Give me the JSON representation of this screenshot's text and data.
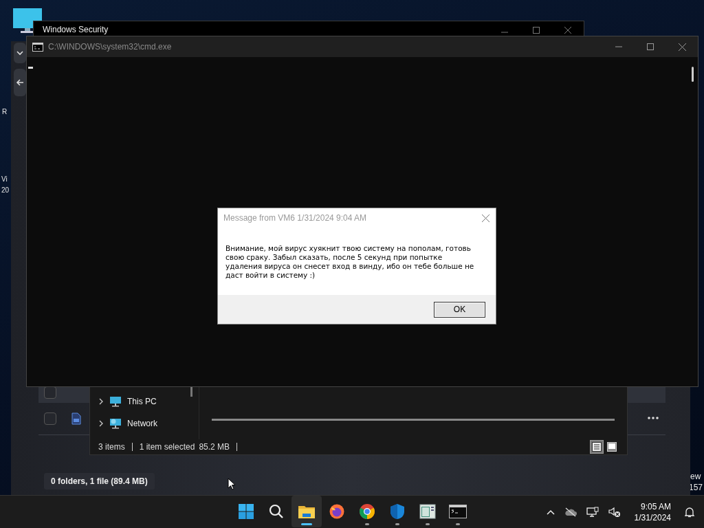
{
  "desktop": {
    "partial_texts": [
      "R",
      "Vi",
      "20",
      "ew",
      "157"
    ]
  },
  "security_window": {
    "title": "Windows Security"
  },
  "background_window": {
    "rows": [
      {
        "checked": false,
        "kind": "plain"
      },
      {
        "checked": false,
        "kind": "file"
      }
    ],
    "summary": "0 folders, 1 file (89.4 MB)"
  },
  "explorer": {
    "nav": [
      {
        "label": "This PC",
        "kind": "pc",
        "expanded": false
      },
      {
        "label": "Network",
        "kind": "network",
        "expanded": false
      }
    ],
    "status": {
      "count": "3 items",
      "selection": "1 item selected",
      "size": "85.2 MB"
    },
    "views": [
      {
        "kind": "details",
        "selected": true
      },
      {
        "kind": "tiles",
        "selected": false
      }
    ]
  },
  "cmd": {
    "title": "C:\\WINDOWS\\system32\\cmd.exe"
  },
  "message": {
    "title": "Message from VM6 1/31/2024 9:04 AM",
    "text": "Внимание, мой вирус хуякнит твою систему на пополам, готовь свою сраку. Забыл сказать, после 5 секунд при попытке удаления вируса он снесет вход в винду, ибо он тебе больше не даст войти в систему :)",
    "button": "OK"
  },
  "taskbar": {
    "apps": [
      {
        "kind": "start",
        "running": false,
        "selected": false
      },
      {
        "kind": "search",
        "running": false,
        "selected": false
      },
      {
        "kind": "explorer",
        "running": true,
        "selected": true
      },
      {
        "kind": "firefox",
        "running": false,
        "selected": false
      },
      {
        "kind": "chrome",
        "running": true,
        "selected": false
      },
      {
        "kind": "shield",
        "running": true,
        "selected": false
      },
      {
        "kind": "window",
        "running": true,
        "selected": false
      },
      {
        "kind": "terminal",
        "running": true,
        "selected": false
      }
    ],
    "time": "9:05 AM",
    "date": "1/31/2024"
  }
}
